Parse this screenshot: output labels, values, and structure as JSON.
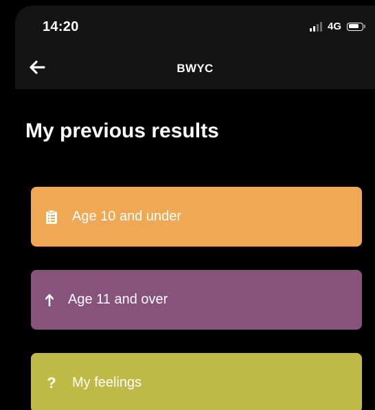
{
  "status_bar": {
    "time": "14:20",
    "network": "4G",
    "signal_icon": "signal-icon",
    "battery_icon": "battery-icon"
  },
  "nav": {
    "back_icon": "arrow-left-icon",
    "title": "BWYC"
  },
  "page": {
    "title": "My previous results"
  },
  "results": [
    {
      "label": "Age 10 and under",
      "icon": "clipboard-icon",
      "color": "#F0A853"
    },
    {
      "label": "Age 11 and over",
      "icon": "arrow-up-icon",
      "color": "#87527C"
    },
    {
      "label": "My feelings",
      "icon": "question-icon",
      "color": "#BEBA45"
    }
  ],
  "colors": {
    "background": "#000000",
    "nav_bar": "#141414",
    "text": "#FFFFFF"
  }
}
